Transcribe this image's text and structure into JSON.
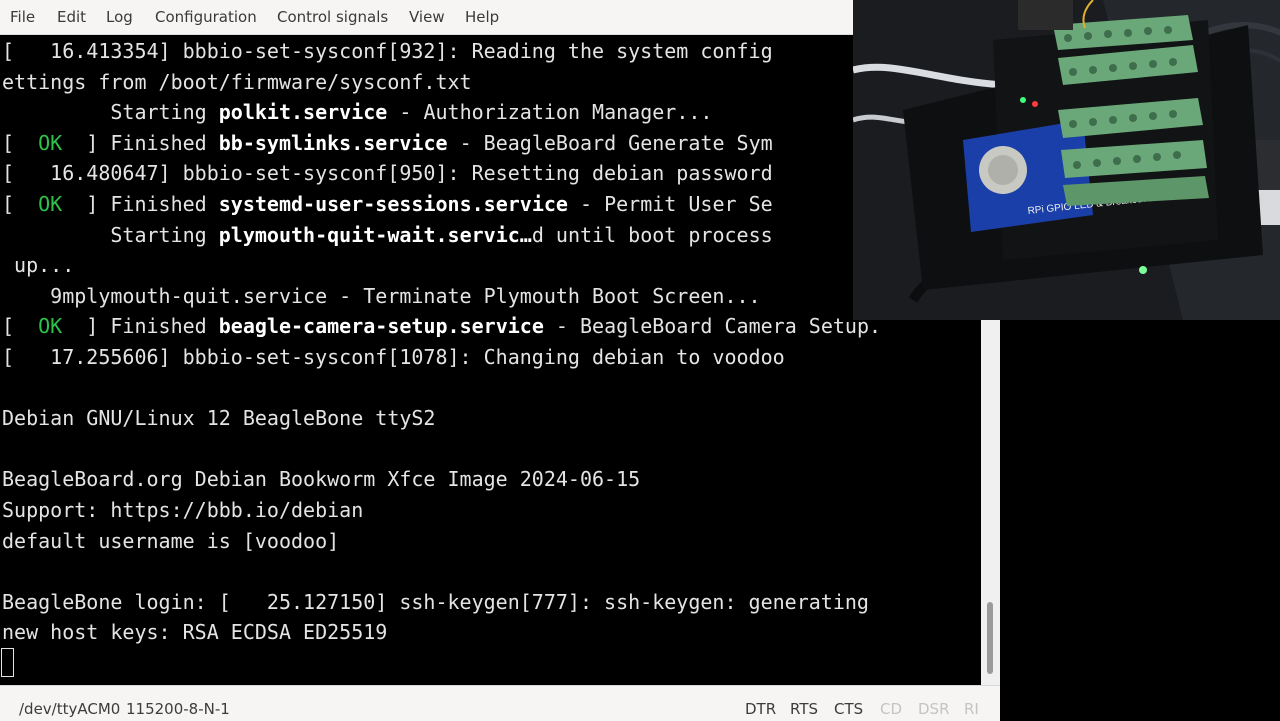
{
  "menubar": {
    "items": [
      "File",
      "Edit",
      "Log",
      "Configuration",
      "Control signals",
      "View",
      "Help"
    ]
  },
  "terminal": {
    "lines": [
      {
        "parts": [
          {
            "t": "[   16.413354] bbbio-set-sysconf[932]: Reading the system config"
          }
        ]
      },
      {
        "parts": [
          {
            "t": "ettings from /boot/firmware/sysconf.txt"
          }
        ]
      },
      {
        "parts": [
          {
            "t": "         Starting "
          },
          {
            "t": "polkit.service",
            "c": "bold"
          },
          {
            "t": " - Authorization Manager..."
          }
        ]
      },
      {
        "parts": [
          {
            "t": "[  "
          },
          {
            "t": "OK",
            "c": "ok"
          },
          {
            "t": "  ] Finished "
          },
          {
            "t": "bb-symlinks.service",
            "c": "bold"
          },
          {
            "t": " - BeagleBoard Generate Sym"
          }
        ]
      },
      {
        "parts": [
          {
            "t": "[   16.480647] bbbio-set-sysconf[950]: Resetting debian password"
          }
        ]
      },
      {
        "parts": [
          {
            "t": "[  "
          },
          {
            "t": "OK",
            "c": "ok"
          },
          {
            "t": "  ] Finished "
          },
          {
            "t": "systemd-user-sessions.service",
            "c": "bold"
          },
          {
            "t": " - Permit User Se"
          }
        ]
      },
      {
        "parts": [
          {
            "t": "         Starting "
          },
          {
            "t": "plymouth-quit-wait.servic…",
            "c": "bold"
          },
          {
            "t": "d until boot process"
          }
        ]
      },
      {
        "parts": [
          {
            "t": " up..."
          }
        ]
      },
      {
        "parts": [
          {
            "t": "    9mplymouth-quit.service - Terminate Plymouth Boot Screen..."
          }
        ]
      },
      {
        "parts": [
          {
            "t": "[  "
          },
          {
            "t": "OK",
            "c": "ok"
          },
          {
            "t": "  ] Finished "
          },
          {
            "t": "beagle-camera-setup.service",
            "c": "bold"
          },
          {
            "t": " - BeagleBoard Camera Setup."
          }
        ]
      },
      {
        "parts": [
          {
            "t": "[   17.255606] bbbio-set-sysconf[1078]: Changing debian to voodoo"
          }
        ]
      },
      {
        "parts": [
          {
            "t": ""
          }
        ]
      },
      {
        "parts": [
          {
            "t": "Debian GNU/Linux 12 BeagleBone ttyS2"
          }
        ]
      },
      {
        "parts": [
          {
            "t": ""
          }
        ]
      },
      {
        "parts": [
          {
            "t": "BeagleBoard.org Debian Bookworm Xfce Image 2024-06-15"
          }
        ]
      },
      {
        "parts": [
          {
            "t": "Support: https://bbb.io/debian"
          }
        ]
      },
      {
        "parts": [
          {
            "t": "default username is [voodoo]"
          }
        ]
      },
      {
        "parts": [
          {
            "t": ""
          }
        ]
      },
      {
        "parts": [
          {
            "t": "BeagleBone login: [   25.127150] ssh-keygen[777]: ssh-keygen: generating"
          }
        ]
      },
      {
        "parts": [
          {
            "t": "new host keys: RSA ECDSA ED25519"
          }
        ]
      }
    ]
  },
  "statusbar": {
    "port": "/dev/ttyACM0",
    "settings": "115200-8-N-1",
    "signals": [
      {
        "label": "DTR",
        "active": true
      },
      {
        "label": "RTS",
        "active": true
      },
      {
        "label": "CTS",
        "active": true
      },
      {
        "label": "CD",
        "active": false
      },
      {
        "label": "DSR",
        "active": false
      },
      {
        "label": "RI",
        "active": false
      }
    ]
  },
  "camera_overlay": {
    "board_text": "RPi GPIO LED & Breakout Board"
  },
  "colors": {
    "terminal_bg": "#000000",
    "terminal_fg": "#e4e4e4",
    "ok_green": "#2ec24a",
    "pcb_blue": "#1a3fa8",
    "terminal_block_green": "#6aa879"
  }
}
